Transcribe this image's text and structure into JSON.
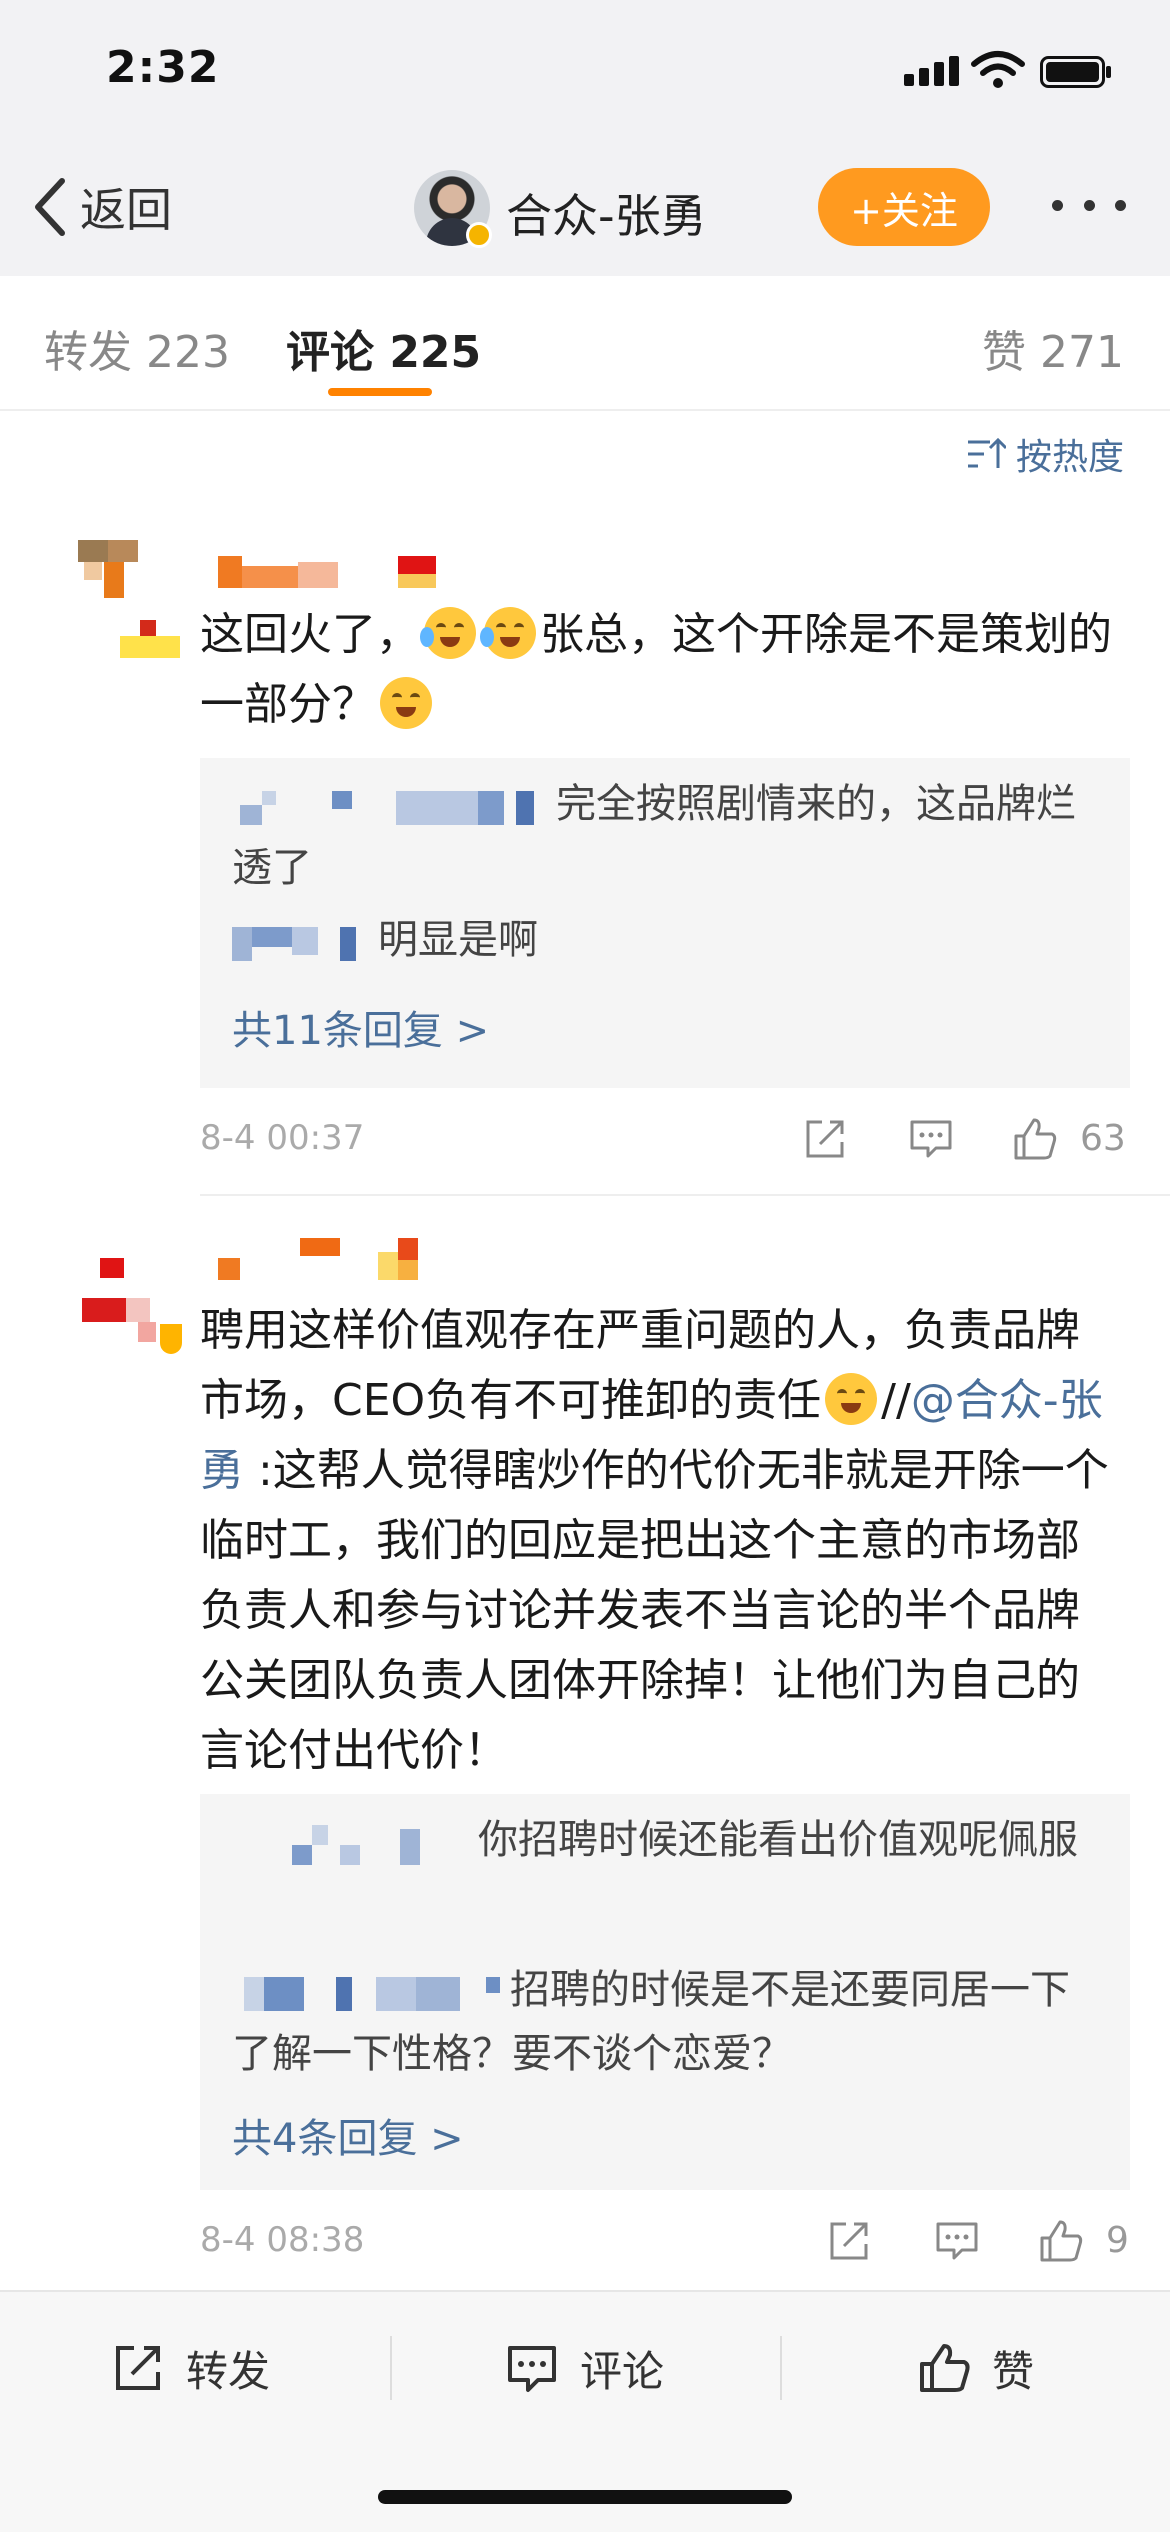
{
  "status_bar": {
    "time": "2:32"
  },
  "nav": {
    "back_label": "返回",
    "title": "合众-张勇",
    "follow_label": "+关注"
  },
  "tabs": {
    "forward": "转发 223",
    "comments": "评论 225",
    "likes": "赞 271"
  },
  "sort_label": "按热度",
  "comments": [
    {
      "text_parts": [
        "这回火了，",
        "张总，这个开除是不是策划的一部分？"
      ],
      "replies": [
        {
          "text": "完全按照剧情来的，这品牌烂透了"
        },
        {
          "text": "明显是啊"
        }
      ],
      "more_replies": "共11条回复 >",
      "time": "8-4 00:37",
      "likes": "63"
    },
    {
      "text_parts": [
        "聘用这样价值观存在严重问题的人，负责品牌市场，CEO负有不可推卸的责任",
        "//",
        "@合众-张勇",
        " :这帮人觉得瞎炒作的代价无非就是开除一个临时工，我们的回应是把出这个主意的市场部负责人和参与讨论并发表不当言论的半个品牌公关团队负责人团体开除掉！让他们为自己的言论付出代价！"
      ],
      "replies": [
        {
          "text": "你招聘时候还能看出价值观呢佩服"
        },
        {
          "text": "招聘的时候是不是还要同居一下了解一下性格？要不谈个恋爱？"
        }
      ],
      "more_replies": "共4条回复 >",
      "time": "8-4 08:38",
      "likes": "9"
    }
  ],
  "bottom_bar": {
    "forward": "转发",
    "comment": "评论",
    "like": "赞"
  },
  "icons": [
    "chevron-left-icon",
    "verified-icon",
    "more-icon",
    "sort-icon",
    "share-icon",
    "comment-icon",
    "thumb-up-icon",
    "emoji-icon"
  ],
  "colors": {
    "accent_orange": "#ff8200",
    "follow_button": "#ff9a1f",
    "link_blue": "#4a6f9a"
  }
}
